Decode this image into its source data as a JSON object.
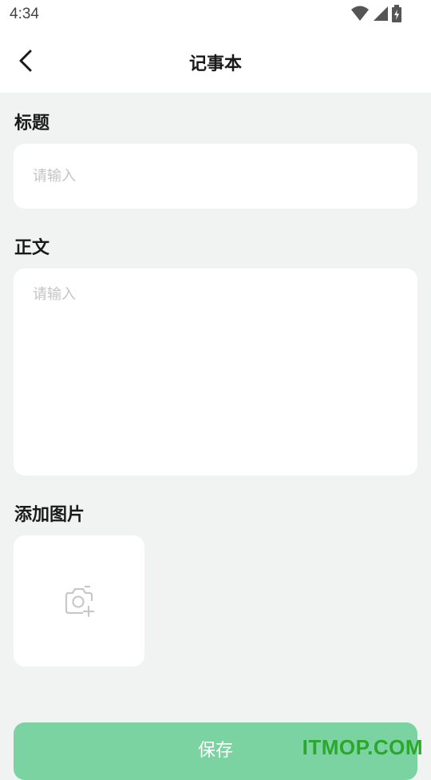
{
  "status_bar": {
    "time": "4:34",
    "icons": [
      "wifi-icon",
      "signal-icon",
      "battery-charging-icon"
    ]
  },
  "app_bar": {
    "back_icon": "chevron-left-icon",
    "title": "记事本"
  },
  "form": {
    "title_label": "标题",
    "title_placeholder": "请输入",
    "body_label": "正文",
    "body_placeholder": "请输入",
    "image_label": "添加图片",
    "add_photo_icon": "camera-add-icon"
  },
  "save_button": {
    "label": "保存"
  },
  "watermark": "ITMOP.COM",
  "colors": {
    "background": "#f0f3f2",
    "primary": "#7ad3a0",
    "watermark": "#2ba82b"
  }
}
